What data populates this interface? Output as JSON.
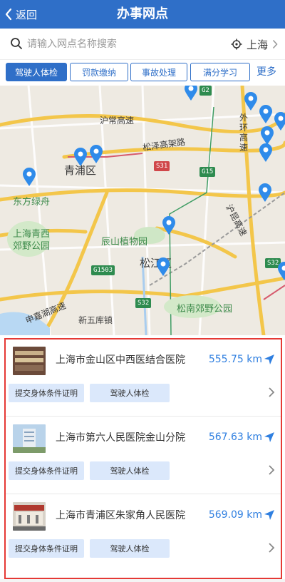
{
  "header": {
    "back_label": "返回",
    "title": "办事网点"
  },
  "search": {
    "placeholder": "请输入网点名称搜索",
    "city": "上海"
  },
  "filters": [
    {
      "label": "驾驶人体检",
      "active": true
    },
    {
      "label": "罚款缴纳",
      "active": false
    },
    {
      "label": "事故处理",
      "active": false
    },
    {
      "label": "满分学习",
      "active": false
    }
  ],
  "filters_more": "更多",
  "map": {
    "labels": {
      "qingpu": "青浦区",
      "songjiang": "松江区",
      "dongfang": "东方绿舟",
      "qingxi": "上海青西\n郊野公园",
      "chenshan": "辰山植物园",
      "songnan": "松南郊野公园",
      "xinwu": "新五库镇",
      "huchang": "沪常高速",
      "songjiang_expressway": "松泽高架路",
      "waihuan": "外环高速",
      "hukun": "沪昆高速",
      "jiajin": "申嘉湖高速"
    },
    "shields": {
      "g15": "G15",
      "g1503": "G1503",
      "s32a": "S32",
      "s32b": "S32",
      "s31": "S31",
      "g2": "G2"
    }
  },
  "hospitals": [
    {
      "name": "上海市金山区中西医结合医院",
      "distance": "555.75 km",
      "tags": [
        "提交身体条件证明",
        "驾驶人体检"
      ]
    },
    {
      "name": "上海市第六人民医院金山分院",
      "distance": "567.63 km",
      "tags": [
        "提交身体条件证明",
        "驾驶人体检"
      ]
    },
    {
      "name": "上海市青浦区朱家角人民医院",
      "distance": "569.09 km",
      "tags": [
        "提交身体条件证明",
        "驾驶人体检"
      ]
    }
  ],
  "colors": {
    "primary": "#2f6fc8",
    "distance": "#2f7fe0",
    "tag_bg": "#dbe8fb",
    "highlight": "#e53935"
  }
}
